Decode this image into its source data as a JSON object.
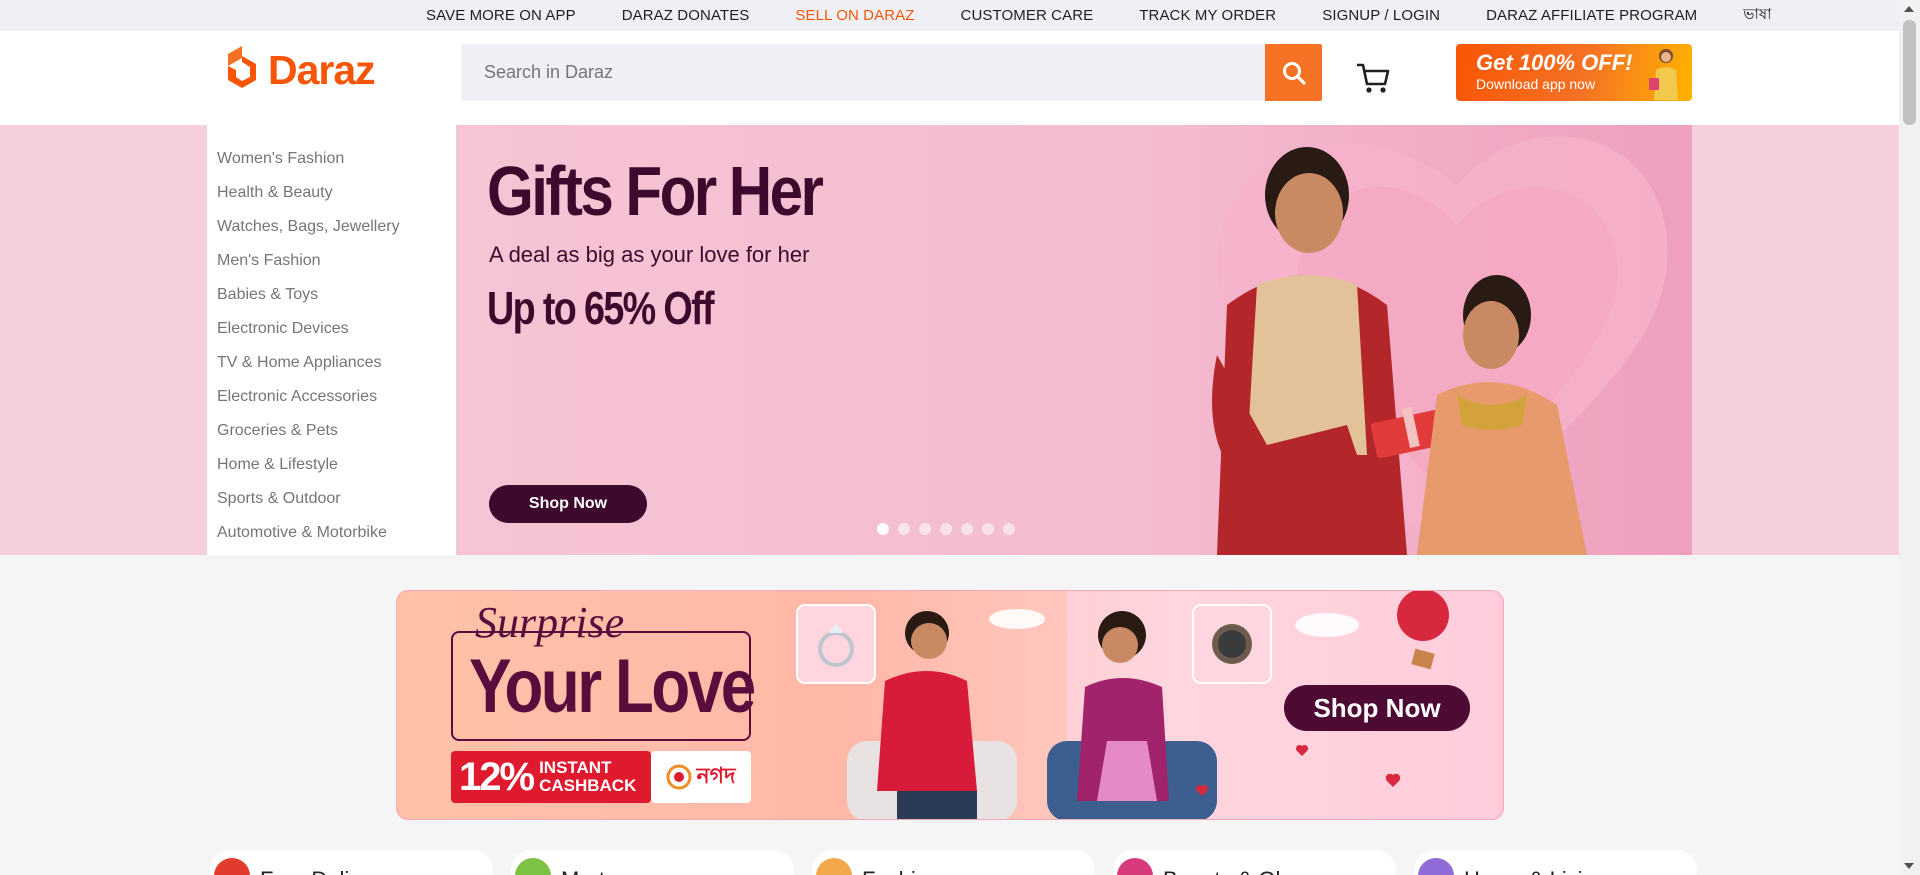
{
  "topbar": {
    "links": [
      {
        "label": "SAVE MORE ON APP"
      },
      {
        "label": "DARAZ DONATES"
      },
      {
        "label": "SELL ON DARAZ"
      },
      {
        "label": "CUSTOMER CARE"
      },
      {
        "label": "TRACK MY ORDER"
      },
      {
        "label": "SIGNUP / LOGIN"
      },
      {
        "label": "DARAZ AFFILIATE PROGRAM"
      },
      {
        "label": "ভাষা"
      }
    ],
    "highlight_color": "#f85606"
  },
  "header": {
    "logo_text": "Daraz",
    "search_placeholder": "Search in Daraz",
    "search_icon": "search-icon",
    "cart_icon": "cart-icon",
    "app_promo": {
      "title": "Get 100% OFF!",
      "subtitle": "Download app now"
    },
    "brand_color": "#f85606"
  },
  "categories": [
    "Women's Fashion",
    "Health & Beauty",
    "Watches, Bags, Jewellery",
    "Men's Fashion",
    "Babies & Toys",
    "Electronic Devices",
    "TV & Home Appliances",
    "Electronic Accessories",
    "Groceries & Pets",
    "Home & Lifestyle",
    "Sports & Outdoor",
    "Automotive & Motorbike"
  ],
  "hero_banner": {
    "title": "Gifts For Her",
    "subtitle": "A deal as big as your love for her",
    "offer": "Up to 65% Off",
    "cta": "Shop Now",
    "slide_count": 7,
    "active_slide": 1
  },
  "promo_strip": {
    "surprise": "Surprise",
    "headline": "Your Love",
    "cashback_percent": "12%",
    "cashback_line1": "INSTANT",
    "cashback_line2": "CASHBACK",
    "partner": "নগদ",
    "cta": "Shop Now"
  },
  "category_pills": [
    {
      "label": "Free Delivery",
      "color": "#e23b2e"
    },
    {
      "label": "Mart",
      "color": "#7cc243"
    },
    {
      "label": "Fashion",
      "color": "#f3a94b"
    },
    {
      "label": "Beauty & Glamour",
      "color": "#d83a7b"
    },
    {
      "label": "Home & Living",
      "color": "#8e6bd6"
    }
  ]
}
